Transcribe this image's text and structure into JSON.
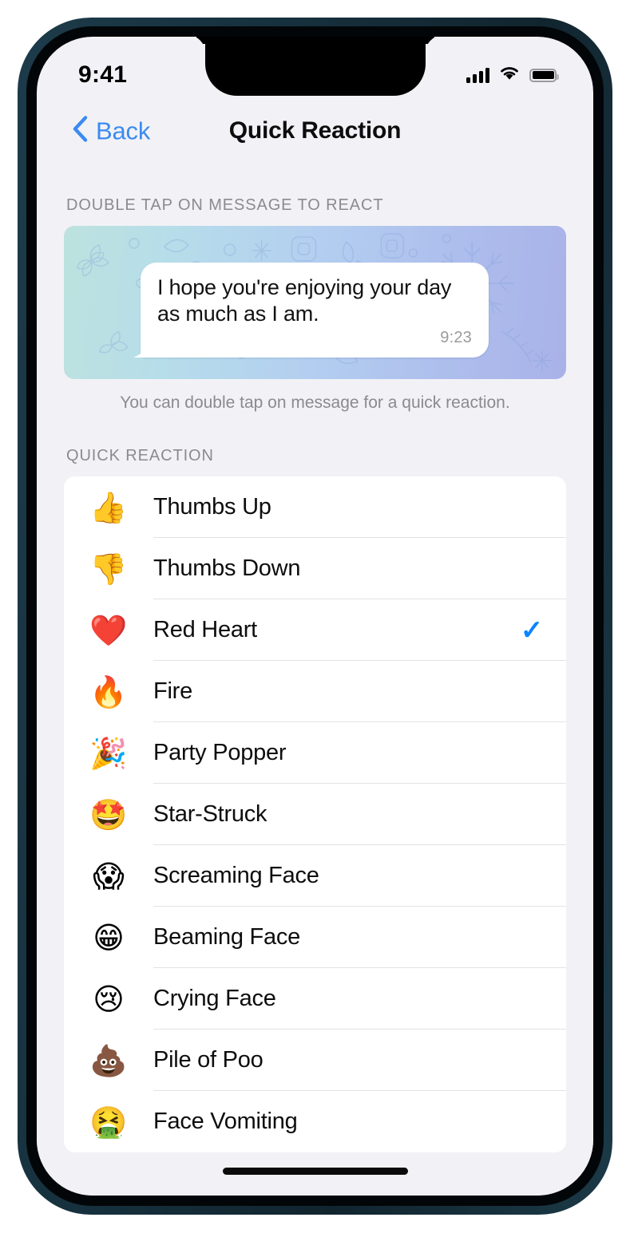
{
  "status_bar": {
    "time": "9:41",
    "signal_icon": "cellular-bars-icon",
    "wifi_icon": "wifi-icon",
    "battery_icon": "battery-full-icon"
  },
  "nav": {
    "back_label": "Back",
    "back_icon": "chevron-left-icon",
    "title": "Quick Reaction"
  },
  "preview_section": {
    "header": "DOUBLE TAP ON MESSAGE TO REACT",
    "footer": "You can double tap on message for a quick reaction.",
    "message": {
      "text": "I hope you're enjoying your day as much as I am.",
      "time": "9:23"
    },
    "wallpaper": {
      "gradient_start": "#bde2df",
      "gradient_end": "#a9b2e8",
      "pattern": "snowflake-doodle-pattern"
    }
  },
  "reaction_section": {
    "header": "QUICK REACTION",
    "selected_check_icon": "checkmark-icon",
    "accent_color": "#0a84ff",
    "items": [
      {
        "emoji": "👍",
        "emoji_name": "thumbs-up-emoji",
        "label": "Thumbs Up",
        "selected": false
      },
      {
        "emoji": "👎",
        "emoji_name": "thumbs-down-emoji",
        "label": "Thumbs Down",
        "selected": false
      },
      {
        "emoji": "❤️",
        "emoji_name": "red-heart-emoji",
        "label": "Red Heart",
        "selected": true
      },
      {
        "emoji": "🔥",
        "emoji_name": "fire-emoji",
        "label": "Fire",
        "selected": false
      },
      {
        "emoji": "🎉",
        "emoji_name": "party-popper-emoji",
        "label": "Party Popper",
        "selected": false
      },
      {
        "emoji": "🤩",
        "emoji_name": "star-struck-emoji",
        "label": "Star-Struck",
        "selected": false
      },
      {
        "emoji": "😱",
        "emoji_name": "screaming-face-emoji",
        "label": "Screaming Face",
        "selected": false
      },
      {
        "emoji": "😁",
        "emoji_name": "beaming-face-emoji",
        "label": "Beaming Face",
        "selected": false
      },
      {
        "emoji": "😢",
        "emoji_name": "crying-face-emoji",
        "label": "Crying Face",
        "selected": false
      },
      {
        "emoji": "💩",
        "emoji_name": "pile-of-poo-emoji",
        "label": "Pile of Poo",
        "selected": false
      },
      {
        "emoji": "🤮",
        "emoji_name": "face-vomiting-emoji",
        "label": "Face Vomiting",
        "selected": false
      }
    ]
  },
  "checkmark_glyph": "✓"
}
